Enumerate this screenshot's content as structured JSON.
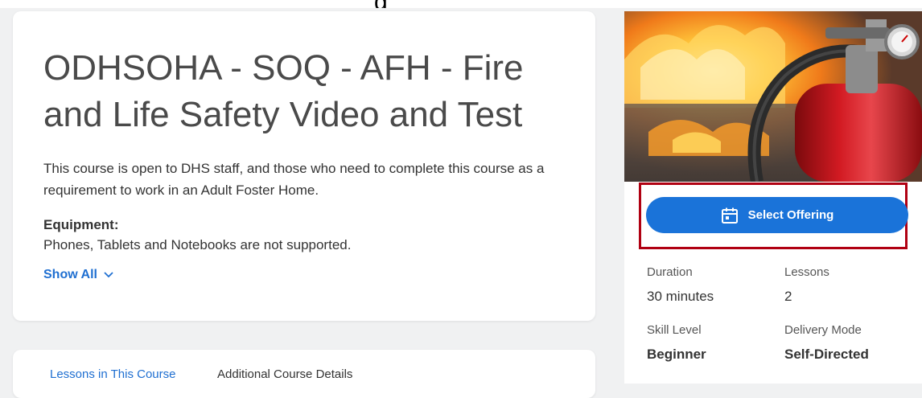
{
  "top_fragment": "g",
  "course": {
    "title": "ODHSOHA - SOQ - AFH - Fire and Life Safety Video and Test",
    "description": "This course is open to DHS staff, and those who need to complete this course as a requirement to work in an Adult Foster Home.",
    "equipment_label": "Equipment:",
    "equipment_text": "Phones, Tablets and Notebooks are not supported.",
    "show_all_label": "Show All"
  },
  "tabs": [
    {
      "label": "Lessons in This Course",
      "active": true
    },
    {
      "label": "Additional Course Details",
      "active": false
    }
  ],
  "hero_image": {
    "icon": "fire-extinguisher-image"
  },
  "offering": {
    "button_label": "Select Offering",
    "icon": "calendar-icon"
  },
  "details": {
    "duration_label": "Duration",
    "duration_value": "30 minutes",
    "lessons_label": "Lessons",
    "lessons_value": "2",
    "skill_label": "Skill Level",
    "skill_value": "Beginner",
    "delivery_label": "Delivery Mode",
    "delivery_value": "Self-Directed"
  },
  "colors": {
    "accent": "#1a73d9",
    "link": "#1f6fd1",
    "highlight": "#b00012",
    "background": "#f0f1f2"
  }
}
